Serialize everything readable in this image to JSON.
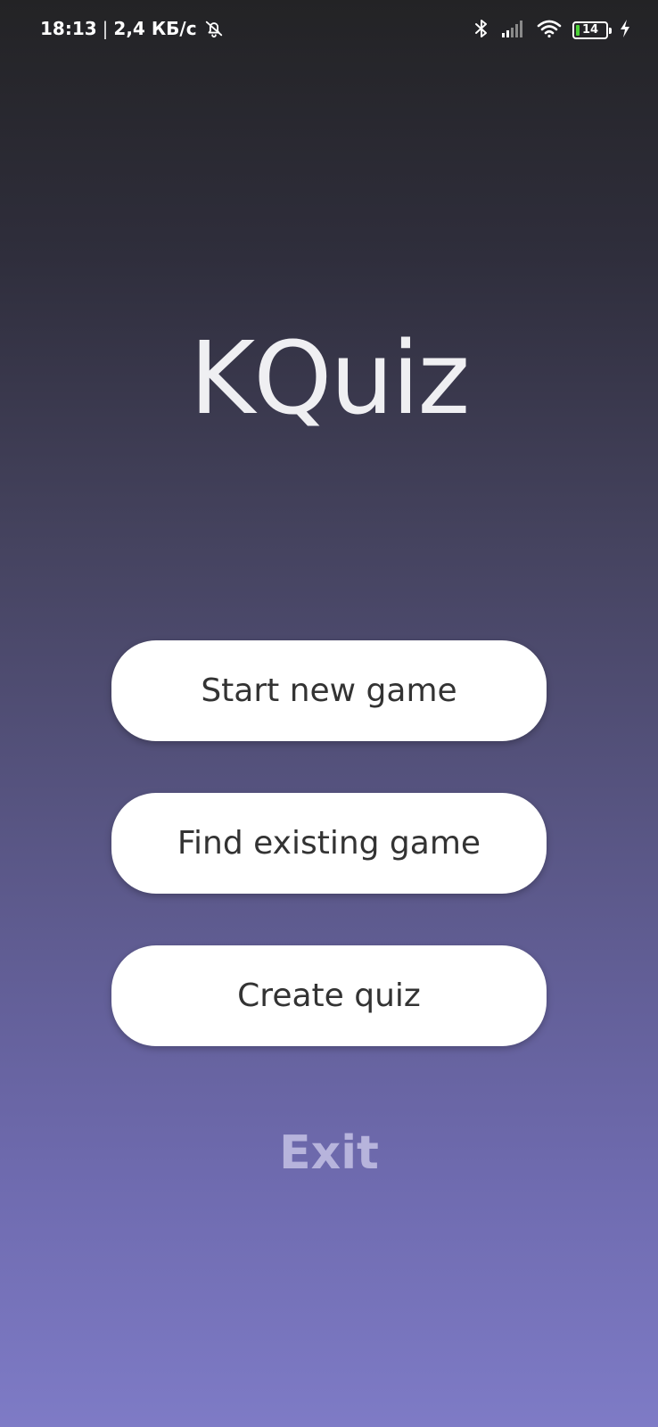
{
  "status_bar": {
    "time": "18:13",
    "separator": "|",
    "network_speed": "2,4 КБ/с",
    "battery_level": "14",
    "battery_fraction": 0.14,
    "icons": [
      "bell-off-icon",
      "bluetooth-icon",
      "signal-icon",
      "wifi-icon",
      "battery-icon",
      "charging-icon"
    ]
  },
  "app": {
    "title": "KQuiz"
  },
  "menu": {
    "start_label": "Start new game",
    "find_label": "Find existing game",
    "create_label": "Create quiz",
    "exit_label": "Exit"
  },
  "colors": {
    "background_top": "#232325",
    "background_bottom": "#7e7bc6",
    "button_bg": "#ffffff",
    "button_text": "#333333",
    "title_text": "#efeff2",
    "exit_text": "#b7b4dc",
    "battery_fill": "#4cd137"
  }
}
